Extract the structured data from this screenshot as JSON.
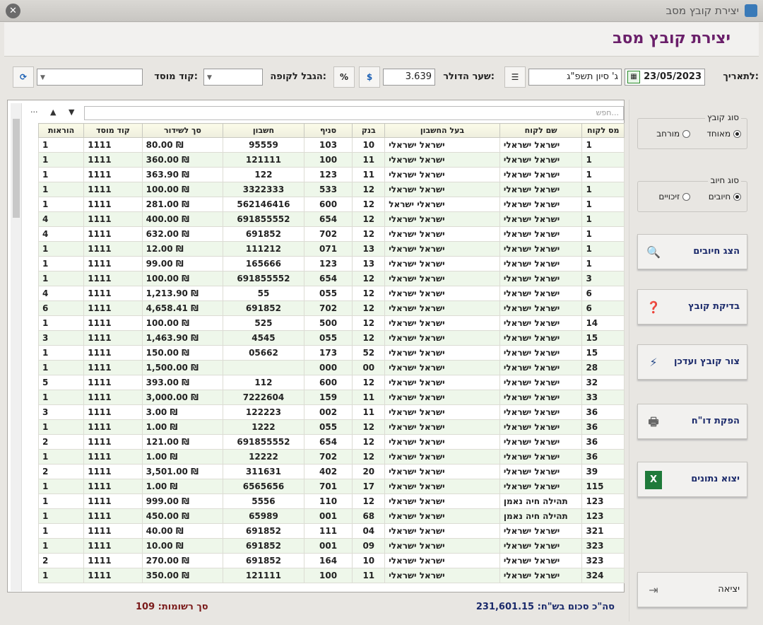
{
  "window": {
    "title": "יצירת קובץ מסב",
    "close": "✕"
  },
  "header": {
    "title": "יצירת קובץ מסב"
  },
  "toolbar": {
    "date_label": "לתאריך:",
    "date": "23/05/2023",
    "hebrew_date": "ג' סיון תשפ\"ג",
    "rate_label": "שער הדולר:",
    "rate": "3.639",
    "cash_label": "הגבל לקופה:",
    "inst_label": "קוד מוסד:"
  },
  "grid": {
    "search_placeholder": "חפש...",
    "columns": [
      "מס לקוח",
      "שם לקוח",
      "בעל החשבון",
      "בנק",
      "סניף",
      "חשבון",
      "סך לשידור",
      "קוד מוסד",
      "הוראות"
    ],
    "rows": [
      [
        "1",
        "ישראל ישראלי",
        "ישראל ישראלי",
        "10",
        "103",
        "95559",
        "₪ 80.00",
        "1111",
        "1"
      ],
      [
        "1",
        "ישראל ישראלי",
        "ישראל ישראלי",
        "11",
        "100",
        "121111",
        "₪ 360.00",
        "1111",
        "1"
      ],
      [
        "1",
        "ישראל ישראלי",
        "ישראל ישראלי",
        "11",
        "123",
        "122",
        "₪ 363.90",
        "1111",
        "1"
      ],
      [
        "1",
        "ישראל ישראלי",
        "ישראל ישראלי",
        "12",
        "533",
        "3322333",
        "₪ 100.00",
        "1111",
        "1"
      ],
      [
        "1",
        "ישראל ישראלי",
        "ישראלי ישראל",
        "12",
        "600",
        "562146416",
        "₪ 281.00",
        "1111",
        "1"
      ],
      [
        "1",
        "ישראל ישראלי",
        "ישראל ישראלי",
        "12",
        "654",
        "691855552",
        "₪ 400.00",
        "1111",
        "4"
      ],
      [
        "1",
        "ישראל ישראלי",
        "ישראל ישראלי",
        "12",
        "702",
        "691852",
        "₪ 632.00",
        "1111",
        "4"
      ],
      [
        "1",
        "ישראל ישראלי",
        "ישראל ישראלי",
        "13",
        "071",
        "111212",
        "₪ 12.00",
        "1111",
        "1"
      ],
      [
        "1",
        "ישראל ישראלי",
        "ישראל ישראלי",
        "13",
        "123",
        "165666",
        "₪ 99.00",
        "1111",
        "1"
      ],
      [
        "3",
        "ישראל ישראלי",
        "ישראל ישראלי",
        "12",
        "654",
        "691855552",
        "₪ 100.00",
        "1111",
        "1"
      ],
      [
        "6",
        "ישראל ישראלי",
        "ישראל ישראלי",
        "12",
        "055",
        "55",
        "₪ 1,213.90",
        "1111",
        "4"
      ],
      [
        "6",
        "ישראל ישראלי",
        "ישראל ישראלי",
        "12",
        "702",
        "691852",
        "₪ 4,658.41",
        "1111",
        "6"
      ],
      [
        "14",
        "ישראל ישראלי",
        "ישראל ישראלי",
        "12",
        "500",
        "525",
        "₪ 100.00",
        "1111",
        "1"
      ],
      [
        "15",
        "ישראל ישראלי",
        "ישראל ישראלי",
        "12",
        "055",
        "4545",
        "₪ 1,463.90",
        "1111",
        "3"
      ],
      [
        "15",
        "ישראל ישראלי",
        "ישראל ישראלי",
        "52",
        "173",
        "05662",
        "₪ 150.00",
        "1111",
        "1"
      ],
      [
        "28",
        "ישראל ישראלי",
        "ישראל ישראלי",
        "00",
        "000",
        "",
        "₪ 1,500.00",
        "1111",
        "1"
      ],
      [
        "32",
        "ישראל ישראלי",
        "ישראל ישראלי",
        "12",
        "600",
        "112",
        "₪ 393.00",
        "1111",
        "5"
      ],
      [
        "33",
        "ישראל ישראלי",
        "ישראל ישראלי",
        "11",
        "159",
        "7222604",
        "₪ 3,000.00",
        "1111",
        "1"
      ],
      [
        "36",
        "ישראל ישראלי",
        "ישראל ישראלי",
        "11",
        "002",
        "122223",
        "₪ 3.00",
        "1111",
        "3"
      ],
      [
        "36",
        "ישראל ישראלי",
        "ישראל ישראלי",
        "12",
        "055",
        "1222",
        "₪ 1.00",
        "1111",
        "1"
      ],
      [
        "36",
        "ישראל ישראלי",
        "ישראל ישראלי",
        "12",
        "654",
        "691855552",
        "₪ 121.00",
        "1111",
        "2"
      ],
      [
        "36",
        "ישראל ישראלי",
        "ישראל ישראלי",
        "12",
        "702",
        "12222",
        "₪ 1.00",
        "1111",
        "1"
      ],
      [
        "39",
        "ישראל ישראלי",
        "ישראל ישראלי",
        "20",
        "402",
        "311631",
        "₪ 3,501.00",
        "1111",
        "2"
      ],
      [
        "115",
        "ישראל ישראלי",
        "ישראל ישראלי",
        "17",
        "701",
        "6565656",
        "₪ 1.00",
        "1111",
        "1"
      ],
      [
        "123",
        "תהילה חיה נאמן",
        "ישראל ישראלי",
        "12",
        "110",
        "5556",
        "₪ 999.00",
        "1111",
        "1"
      ],
      [
        "123",
        "תהילה חיה נאמן",
        "ישראל ישראלי",
        "68",
        "001",
        "65989",
        "₪ 450.00",
        "1111",
        "1"
      ],
      [
        "321",
        "ישראל ישראלי",
        "ישראל ישראלי",
        "04",
        "111",
        "691852",
        "₪ 40.00",
        "1111",
        "1"
      ],
      [
        "323",
        "ישראל ישראלי",
        "ישראל ישראלי",
        "09",
        "001",
        "691852",
        "₪ 10.00",
        "1111",
        "1"
      ],
      [
        "323",
        "ישראל ישראלי",
        "ישראל ישראלי",
        "10",
        "164",
        "691852",
        "₪ 270.00",
        "1111",
        "2"
      ],
      [
        "324",
        "ישראל ישראלי",
        "ישראל ישראלי",
        "11",
        "100",
        "121111",
        "₪ 350.00",
        "1111",
        "1"
      ]
    ]
  },
  "footer": {
    "total_label": "סה\"כ סכום בש\"ח:",
    "total": "231,601.15",
    "count_label": "סך רשומות:",
    "count": "109"
  },
  "side": {
    "file_type": {
      "title": "סוג קובץ",
      "opt1": "מאוחד",
      "opt2": "מורחב"
    },
    "charge_type": {
      "title": "סוג חיוב",
      "opt1": "חיובים",
      "opt2": "זיכויים"
    },
    "buttons": [
      "הצג חיובים",
      "בדיקת קובץ",
      "צור קובץ ועדכן",
      "הפקת דו\"ח",
      "יצוא נתונים",
      "יציאה"
    ]
  }
}
